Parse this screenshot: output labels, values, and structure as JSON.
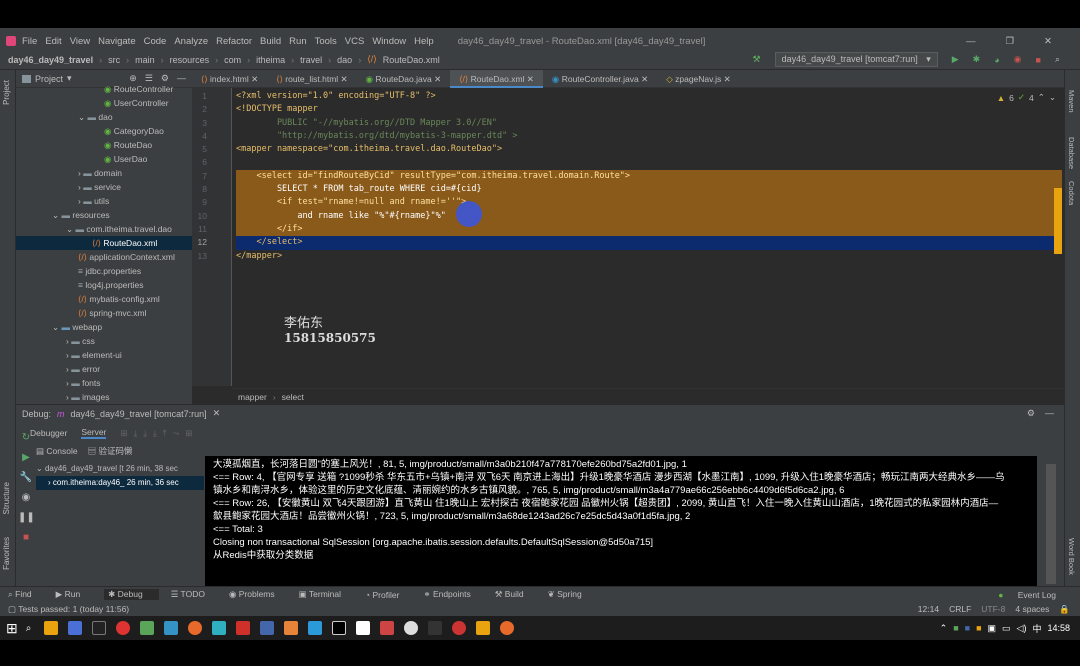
{
  "titlebar": {
    "menu": [
      "File",
      "Edit",
      "View",
      "Navigate",
      "Code",
      "Analyze",
      "Refactor",
      "Build",
      "Run",
      "Tools",
      "VCS",
      "Window",
      "Help"
    ],
    "title": "day46_day49_travel - RouteDao.xml [day46_day49_travel]",
    "run_config": "day46_day49_travel [tomcat7:run]"
  },
  "nav": [
    "day46_day49_travel",
    "src",
    "main",
    "resources",
    "com",
    "itheima",
    "travel",
    "dao",
    "RouteDao.xml"
  ],
  "project": {
    "header": "Project",
    "tree": [
      "RouteController",
      "UserController",
      "dao",
      "CategoryDao",
      "RouteDao",
      "UserDao",
      "domain",
      "service",
      "utils",
      "resources",
      "com.itheima.travel.dao",
      "RouteDao.xml",
      "applicationContext.xml",
      "jdbc.properties",
      "log4j.properties",
      "mybatis-config.xml",
      "spring-mvc.xml",
      "webapp",
      "css",
      "element-ui",
      "error",
      "fonts",
      "images"
    ]
  },
  "tabs": [
    "index.html",
    "route_list.html",
    "RouteDao.java",
    "RouteDao.xml",
    "RouteController.java",
    "zpageNav.js"
  ],
  "editor": {
    "lines": [
      "1",
      "2",
      "3",
      "4",
      "5",
      "6",
      "7",
      "8",
      "9",
      "10",
      "11",
      "12",
      "13"
    ],
    "code": [
      "<?xml version=\"1.0\" encoding=\"UTF-8\" ?>",
      "<!DOCTYPE mapper",
      "        PUBLIC \"-//mybatis.org//DTD Mapper 3.0//EN\"",
      "        \"http://mybatis.org/dtd/mybatis-3-mapper.dtd\" >",
      "<mapper namespace=\"com.itheima.travel.dao.RouteDao\">",
      "",
      "    <select id=\"findRouteByCid\" resultType=\"com.itheima.travel.domain.Route\">",
      "        SELECT * FROM tab_route WHERE cid=#{cid}",
      "        <if test=\"rname!=null and rname!=''\">",
      "            and rname like \"%\"#{rname}\"%\"",
      "        </if>",
      "    </select>",
      "</mapper>"
    ],
    "watermark_name": "李佑东",
    "watermark_phone": "15815850575",
    "breadcrumb": [
      "mapper",
      "select"
    ],
    "inspections": {
      "warnings": "6",
      "ok": "4"
    }
  },
  "debug": {
    "label": "Debug:",
    "config": "day46_day49_travel [tomcat7:run]",
    "tabs": [
      "Debugger",
      "Server"
    ],
    "console_tabs": [
      "Console",
      "验证码懒"
    ],
    "frames": [
      "day46_day49_travel [t  26 min, 38 sec",
      "com.itheima:day46_  26 min, 36 sec"
    ]
  },
  "console": [
    "大漠孤烟直，长河落日圆\"的塞上风光！, 81, 5, img/product/small/m3a0b210f47a778170efe260bd75a2fd01.jpg, 1",
    "<==       Row: 4, 【官网专享 送箱 ?1099秒杀 华东五市+乌镇+南浔 双飞6天 南京进上海出】升级1晚豪华酒店 漫步西湖【水墨江南】, 1099, 升级入住1晚豪华酒店；畅玩江南两大经典水乡——乌",
    "    镇水乡和南浔水乡，体验这里的历史文化底蕴、清丽婉约的水乡古镇风貌。, 765, 5, img/product/small/m3a4a779ae66c256ebb6c4409d6f5d6ca2.jpg, 6",
    "<==       Row: 26, 【安徽黄山 双飞4天跟团游】直飞黄山 住1晚山上 宏村探古 夜宿鲍家花园 品徽州火锅【超贵团】, 2099, 黄山直飞！入住一晚入住黄山山酒店，1晚花园式的私家园林内酒店—",
    "    歙县鲍家花园大酒店！品尝徽州火锅！, 723, 5, img/product/small/m3a68de1243ad26c7e25dc5d43a0f1d5fa.jpg, 2",
    "<==      Total: 3",
    "Closing non transactional SqlSession [org.apache.ibatis.session.defaults.DefaultSqlSession@5d50a715]",
    "从Redis中获取分类数据"
  ],
  "bottom_tabs": [
    "Find",
    "Run",
    "Debug",
    "TODO",
    "Problems",
    "Terminal",
    "Profiler",
    "Endpoints",
    "Build",
    "Spring",
    "Event Log"
  ],
  "status": {
    "left": "Tests passed: 1 (today 11:56)",
    "pos": "12:14",
    "crlf": "CRLF",
    "enc": "UTF-8",
    "indent": "4 spaces"
  },
  "taskbar": {
    "time": "14:58"
  },
  "colors": {
    "bg": "#3c3f41",
    "editor": "#2b2b2b",
    "highlight": "#8a5a1a",
    "selection": "#0c2a6e",
    "accent": "#4a88c7"
  }
}
